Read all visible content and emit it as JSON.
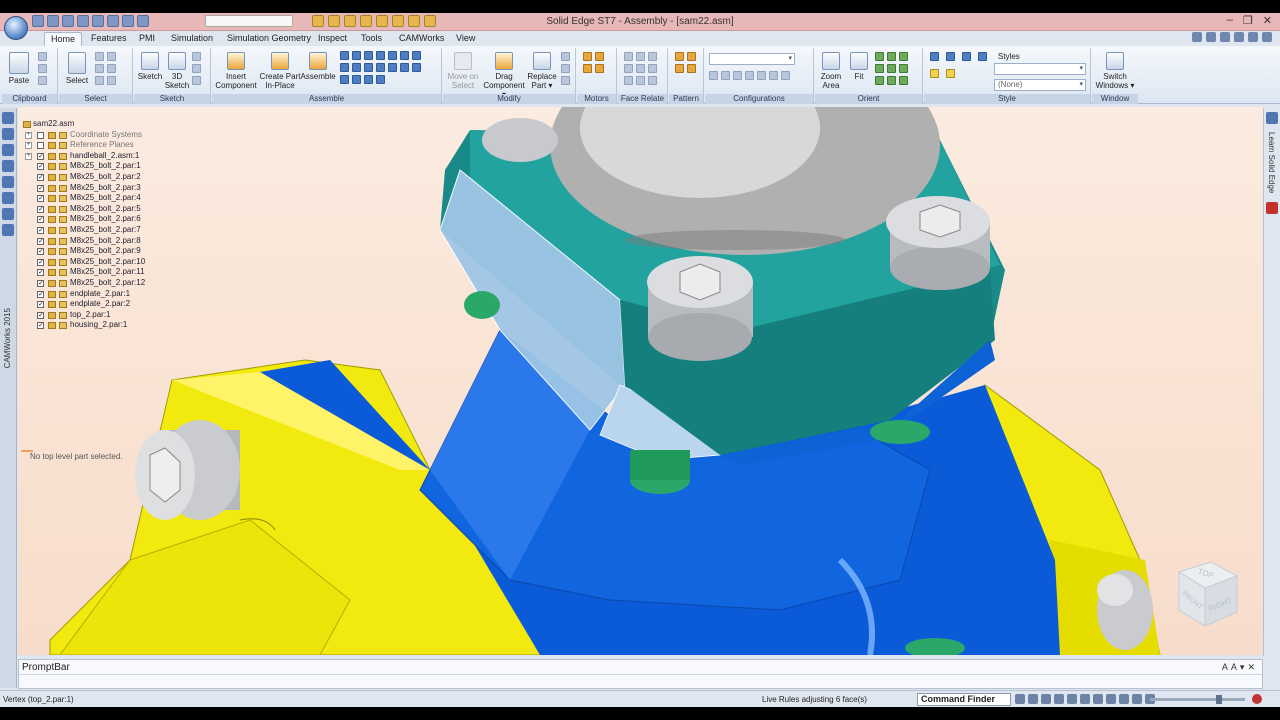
{
  "window": {
    "title": "Solid Edge ST7 - Assembly - [sam22.asm]"
  },
  "tabs": [
    "Home",
    "Features",
    "PMI",
    "Simulation",
    "Simulation Geometry",
    "Inspect",
    "Tools",
    "CAMWorks",
    "View"
  ],
  "ribbon": {
    "clipboard": {
      "label": "Clipboard",
      "paste": "Paste"
    },
    "select": {
      "label": "Select",
      "select": "Select"
    },
    "sketch": {
      "label": "Sketch",
      "sketch": "Sketch",
      "sketch3d_a": "3D",
      "sketch3d_b": "Sketch"
    },
    "assemble": {
      "label": "Assemble",
      "insert_a": "Insert",
      "insert_b": "Component",
      "create_a": "Create Part",
      "create_b": "In-Place",
      "assemble": "Assemble"
    },
    "modify": {
      "label": "Modify",
      "move_a": "Move on",
      "move_b": "Select",
      "drag_a": "Drag",
      "drag_b": "Component",
      "replace_a": "Replace",
      "replace_b": "Part"
    },
    "motors": {
      "label": "Motors"
    },
    "face_relate": {
      "label": "Face Relate"
    },
    "pattern": {
      "label": "Pattern"
    },
    "configurations": {
      "label": "Configurations"
    },
    "orient": {
      "label": "Orient",
      "zoom_a": "Zoom",
      "zoom_b": "Area",
      "fit": "Fit"
    },
    "style": {
      "label": "Style",
      "styles": "Styles",
      "none": "(None)"
    },
    "window": {
      "label": "Window",
      "switch_a": "Switch",
      "switch_b": "Windows"
    }
  },
  "tree": {
    "root": "sam22.asm",
    "items": [
      {
        "label": "Coordinate Systems",
        "expander": "+",
        "checked": false,
        "muted": true
      },
      {
        "label": "Reference Planes",
        "expander": "+",
        "checked": false,
        "muted": true
      },
      {
        "label": "handleball_2.asm:1",
        "expander": "+",
        "checked": true,
        "muted": false
      },
      {
        "label": "M8x25_bolt_2.par:1",
        "expander": "",
        "checked": true,
        "muted": false
      },
      {
        "label": "M8x25_bolt_2.par:2",
        "expander": "",
        "checked": true,
        "muted": false
      },
      {
        "label": "M8x25_bolt_2.par:3",
        "expander": "",
        "checked": true,
        "muted": false
      },
      {
        "label": "M8x25_bolt_2.par:4",
        "expander": "",
        "checked": true,
        "muted": false
      },
      {
        "label": "M8x25_bolt_2.par:5",
        "expander": "",
        "checked": true,
        "muted": false
      },
      {
        "label": "M8x25_bolt_2.par:6",
        "expander": "",
        "checked": true,
        "muted": false
      },
      {
        "label": "M8x25_bolt_2.par:7",
        "expander": "",
        "checked": true,
        "muted": false
      },
      {
        "label": "M8x25_bolt_2.par:8",
        "expander": "",
        "checked": true,
        "muted": false
      },
      {
        "label": "M8x25_bolt_2.par:9",
        "expander": "",
        "checked": true,
        "muted": false
      },
      {
        "label": "M8x25_bolt_2.par:10",
        "expander": "",
        "checked": true,
        "muted": false
      },
      {
        "label": "M8x25_bolt_2.par:11",
        "expander": "",
        "checked": true,
        "muted": false
      },
      {
        "label": "M8x25_bolt_2.par:12",
        "expander": "",
        "checked": true,
        "muted": false
      },
      {
        "label": "endplate_2.par:1",
        "expander": "",
        "checked": true,
        "muted": false
      },
      {
        "label": "endplate_2.par:2",
        "expander": "",
        "checked": true,
        "muted": false
      },
      {
        "label": "top_2.par:1",
        "expander": "",
        "checked": true,
        "muted": false
      },
      {
        "label": "housing_2.par:1",
        "expander": "",
        "checked": true,
        "muted": false
      }
    ],
    "message": "No top level part selected."
  },
  "viewcube": {
    "top": "TOP",
    "front": "FRONT",
    "right": "RIGHT"
  },
  "side_strips": {
    "left_vertical": "CAMWorks 2015",
    "right_vertical": "Learn Solid Edge"
  },
  "promptbar": {
    "title": "PromptBar"
  },
  "statusbar": {
    "left": "Vertex (top_2.par:1)",
    "middle": "Live Rules adjusting 6 face(s)",
    "command_finder": "Command Finder"
  },
  "colors": {
    "housing_yellow": "#f2ea0e",
    "body_blue": "#0b5bd8",
    "top_teal": "#1a8a88",
    "bolt_gray": "#c7c9cc",
    "ball_gray": "#b0b0b0",
    "highlight": "#9fc6e6",
    "title_bar": "#e8b7b7"
  }
}
